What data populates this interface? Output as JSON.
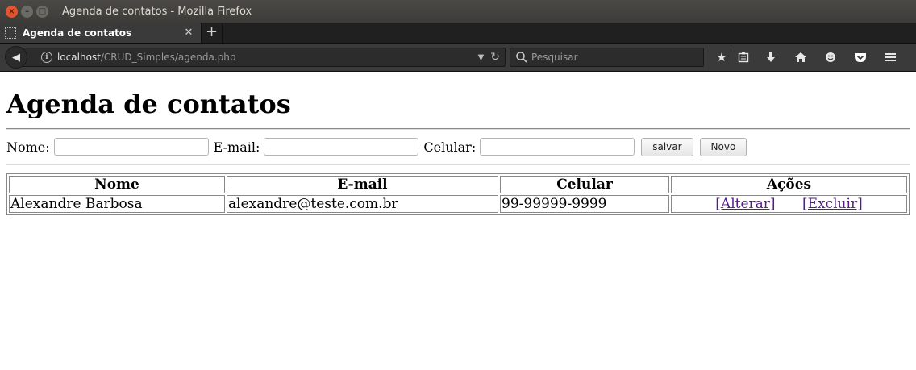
{
  "window": {
    "title": "Agenda de contatos - Mozilla Firefox"
  },
  "tabs": [
    {
      "label": "Agenda de contatos",
      "active": true
    }
  ],
  "navbar": {
    "url_host": "localhost",
    "url_path": "/CRUD_Simples/agenda.php",
    "search_placeholder": "Pesquisar",
    "icons": [
      "back-arrow-icon",
      "info-icon",
      "reload-icon",
      "search-icon",
      "bookmark-star-icon",
      "reading-list-icon",
      "download-icon",
      "home-icon",
      "hello-smiley-icon",
      "pocket-icon",
      "menu-icon"
    ]
  },
  "page": {
    "title": "Agenda de contatos",
    "form": {
      "name_label": "Nome:",
      "email_label": "E-mail:",
      "phone_label": "Celular:",
      "name_value": "",
      "email_value": "",
      "phone_value": "",
      "save_label": "salvar",
      "new_label": "Novo"
    },
    "table": {
      "headers": [
        "Nome",
        "E-mail",
        "Celular",
        "Ações"
      ],
      "rows": [
        {
          "name": "Alexandre Barbosa",
          "email": "alexandre@teste.com.br",
          "phone": "99-99999-9999",
          "edit_label": "[Alterar]",
          "delete_label": "[Excluir]"
        }
      ]
    }
  },
  "colors": {
    "titlebar": "#3c3b37",
    "toolbar": "#3a3a3a",
    "link_visited": "#551a8b"
  }
}
